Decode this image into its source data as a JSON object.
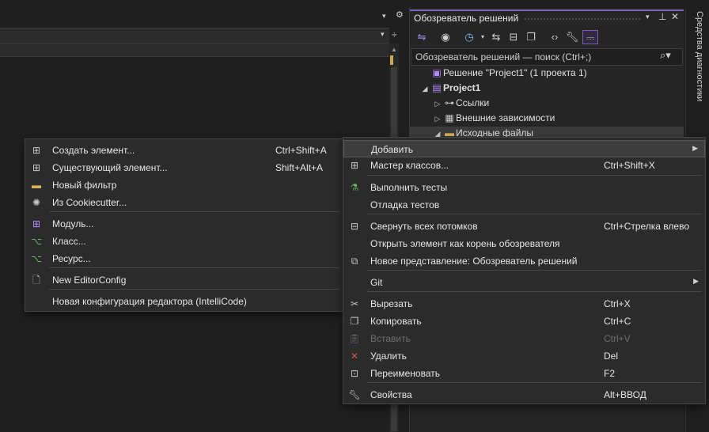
{
  "solution_explorer": {
    "title": "Обозреватель решений",
    "search_placeholder": "Обозреватель решений — поиск (Ctrl+;)",
    "tree": [
      {
        "label": "Решение \"Project1\"  (1 проекта 1)",
        "icon": "solution-icon",
        "expander": ""
      },
      {
        "label": "Project1",
        "icon": "project-icon",
        "expander": "◢"
      },
      {
        "label": "Ссылки",
        "icon": "references-icon",
        "expander": "▷"
      },
      {
        "label": "Внешние зависимости",
        "icon": "external-deps-icon",
        "expander": "▷"
      },
      {
        "label": "Исходные файлы",
        "icon": "folder-icon",
        "expander": "◢"
      }
    ]
  },
  "diagnostics_tab": "Средства диагностики",
  "context_menu": {
    "items": [
      {
        "label": "Добавить",
        "shortcut": "",
        "submenu": true,
        "icon": ""
      },
      {
        "label": "Мастер классов...",
        "shortcut": "Ctrl+Shift+X",
        "icon": "class-wizard-icon"
      },
      {
        "label": "Выполнить тесты",
        "shortcut": "",
        "icon": "run-tests-icon"
      },
      {
        "label": "Отладка тестов",
        "shortcut": "",
        "icon": ""
      },
      {
        "label": "Свернуть всех потомков",
        "shortcut": "Ctrl+Стрелка влево",
        "icon": "collapse-all-icon"
      },
      {
        "label": "Открыть элемент как корень обозревателя",
        "shortcut": "",
        "icon": ""
      },
      {
        "label": "Новое представление: Обозреватель решений",
        "shortcut": "",
        "icon": "new-view-icon"
      },
      {
        "label": "Git",
        "shortcut": "",
        "submenu": true,
        "icon": ""
      },
      {
        "label": "Вырезать",
        "shortcut": "Ctrl+X",
        "icon": "cut-icon"
      },
      {
        "label": "Копировать",
        "shortcut": "Ctrl+C",
        "icon": "copy-icon"
      },
      {
        "label": "Вставить",
        "shortcut": "Ctrl+V",
        "icon": "paste-icon",
        "disabled": true
      },
      {
        "label": "Удалить",
        "shortcut": "Del",
        "icon": "delete-icon"
      },
      {
        "label": "Переименовать",
        "shortcut": "F2",
        "icon": "rename-icon"
      },
      {
        "label": "Свойства",
        "shortcut": "Alt+ВВОД",
        "icon": "properties-icon"
      }
    ]
  },
  "add_submenu": {
    "items": [
      {
        "label": "Создать элемент...",
        "shortcut": "Ctrl+Shift+A",
        "icon": "new-item-icon"
      },
      {
        "label": "Существующий элемент...",
        "shortcut": "Shift+Alt+A",
        "icon": "existing-item-icon"
      },
      {
        "label": "Новый фильтр",
        "shortcut": "",
        "icon": "new-filter-icon"
      },
      {
        "label": "Из Cookiecutter...",
        "shortcut": "",
        "icon": "cookiecutter-icon"
      },
      {
        "label": "Модуль...",
        "shortcut": "",
        "icon": "module-icon"
      },
      {
        "label": "Класс...",
        "shortcut": "",
        "icon": "class-icon"
      },
      {
        "label": "Ресурс...",
        "shortcut": "",
        "icon": "resource-icon"
      },
      {
        "label": "New EditorConfig",
        "shortcut": "",
        "icon": "editorconfig-icon"
      },
      {
        "label": "Новая конфигурация редактора (IntelliCode)",
        "shortcut": "",
        "icon": ""
      }
    ]
  },
  "colors": {
    "accent": "#7a5fbf",
    "menu_bg": "#2b2b2b",
    "delete": "#d9534f",
    "test_green": "#5fb85f"
  }
}
